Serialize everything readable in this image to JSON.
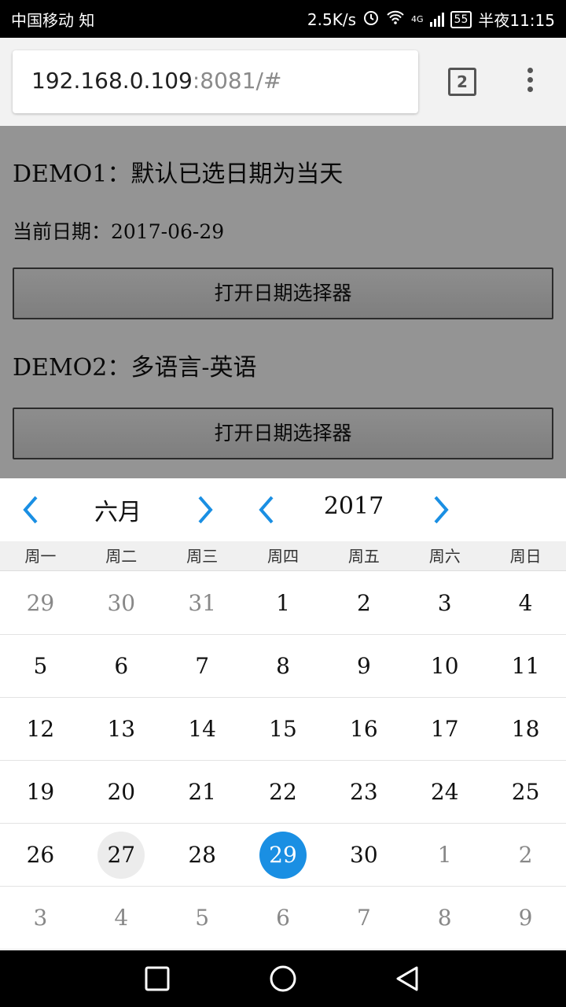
{
  "status_bar": {
    "carrier": "中国移动 知",
    "speed": "2.5K/s",
    "network": "4G",
    "battery": "55",
    "time": "半夜11:15"
  },
  "browser": {
    "url_host": "192.168.0.109",
    "url_rest": ":8081/#",
    "tab_count": "2"
  },
  "page": {
    "demo1_title": "DEMO1：默认已选日期为当天",
    "current_date_label": "当前日期：",
    "current_date_value": "2017-06-29",
    "open_picker_label_1": "打开日期选择器",
    "demo2_title": "DEMO2：多语言-英语",
    "open_picker_label_2": "打开日期选择器"
  },
  "picker": {
    "month": "六月",
    "year": "2017",
    "accent_color": "#1a8fe3",
    "weekdays": [
      "周一",
      "周二",
      "周三",
      "周四",
      "周五",
      "周六",
      "周日"
    ],
    "today": "27",
    "selected": "29",
    "weeks": [
      [
        {
          "d": "29",
          "other": true
        },
        {
          "d": "30",
          "other": true
        },
        {
          "d": "31",
          "other": true
        },
        {
          "d": "1"
        },
        {
          "d": "2"
        },
        {
          "d": "3"
        },
        {
          "d": "4"
        }
      ],
      [
        {
          "d": "5"
        },
        {
          "d": "6"
        },
        {
          "d": "7"
        },
        {
          "d": "8"
        },
        {
          "d": "9"
        },
        {
          "d": "10"
        },
        {
          "d": "11"
        }
      ],
      [
        {
          "d": "12"
        },
        {
          "d": "13"
        },
        {
          "d": "14"
        },
        {
          "d": "15"
        },
        {
          "d": "16"
        },
        {
          "d": "17"
        },
        {
          "d": "18"
        }
      ],
      [
        {
          "d": "19"
        },
        {
          "d": "20"
        },
        {
          "d": "21"
        },
        {
          "d": "22"
        },
        {
          "d": "23"
        },
        {
          "d": "24"
        },
        {
          "d": "25"
        }
      ],
      [
        {
          "d": "26"
        },
        {
          "d": "27",
          "today": true
        },
        {
          "d": "28"
        },
        {
          "d": "29",
          "selected": true
        },
        {
          "d": "30"
        },
        {
          "d": "1",
          "other": true
        },
        {
          "d": "2",
          "other": true
        }
      ],
      [
        {
          "d": "3",
          "other": true
        },
        {
          "d": "4",
          "other": true
        },
        {
          "d": "5",
          "other": true
        },
        {
          "d": "6",
          "other": true
        },
        {
          "d": "7",
          "other": true
        },
        {
          "d": "8",
          "other": true
        },
        {
          "d": "9",
          "other": true
        }
      ]
    ]
  },
  "icons": {
    "prev_month": "chevron-left-icon",
    "next_month": "chevron-right-icon",
    "prev_year": "chevron-left-icon",
    "next_year": "chevron-right-icon",
    "nav_recent": "square-icon",
    "nav_home": "circle-icon",
    "nav_back": "triangle-back-icon"
  }
}
